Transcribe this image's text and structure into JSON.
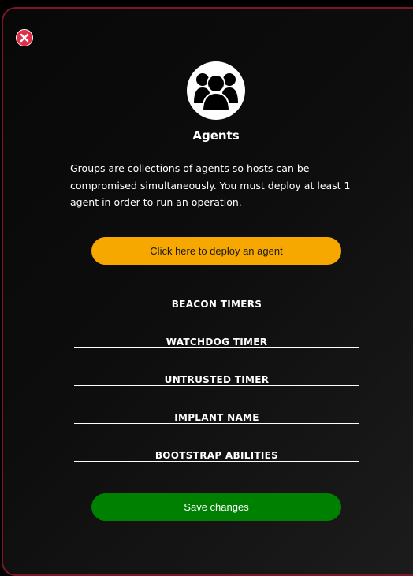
{
  "modal": {
    "close_icon": "close-icon",
    "avatar_icon": "users-group-icon",
    "title": "Agents",
    "description": "Groups are collections of agents so hosts can be compromised simultaneously. You must deploy at least 1 agent in order to run an operation.",
    "deploy_button": "Click here to deploy an agent",
    "fields": [
      {
        "label": "BEACON TIMERS"
      },
      {
        "label": "WATCHDOG TIMER"
      },
      {
        "label": "UNTRUSTED TIMER"
      },
      {
        "label": "IMPLANT NAME"
      },
      {
        "label": "BOOTSTRAP ABILITIES"
      }
    ],
    "save_button": "Save changes"
  },
  "colors": {
    "border": "#7a1828",
    "close": "#e03048",
    "deploy": "#f7a800",
    "save": "#008000"
  }
}
